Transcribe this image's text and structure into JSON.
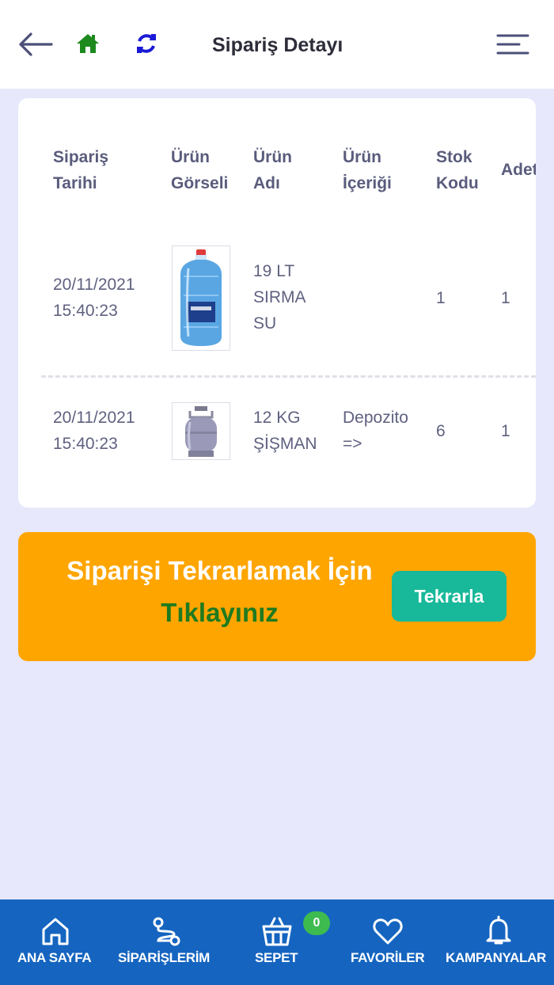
{
  "header": {
    "title": "Sipariş Detayı",
    "icons": [
      "arrow-left-icon",
      "home-icon",
      "refresh-icon",
      "hamburger-menu-icon"
    ]
  },
  "table": {
    "columns": [
      "Sipariş\nTarihi",
      "Ürün\nGörseli",
      "Ürün\nAdı",
      "Ürün\nİçeriği",
      "Stok\nKodu",
      "Adet"
    ],
    "rows": [
      {
        "date": "20/11/2021\n15:40:23",
        "image": "water-bottle-19lt",
        "name": "19 LT\nSIRMA\nSU",
        "content": "",
        "stock_code": "1",
        "quantity": "1"
      },
      {
        "date": "20/11/2021\n15:40:23",
        "image": "gas-cylinder-12kg",
        "name": "12 KG\nŞİŞMAN",
        "content": "Depozito\n=>",
        "stock_code": "6",
        "quantity": "1"
      }
    ]
  },
  "banner": {
    "line1": "Siparişi Tekrarlamak İçin",
    "line2": "Tıklayınız",
    "button_label": "Tekrarla"
  },
  "bottom_nav": {
    "items": [
      {
        "label": "ANA SAYFA",
        "icon": "home-outline-icon"
      },
      {
        "label": "SİPARİŞLERİM",
        "icon": "route-icon"
      },
      {
        "label": "SEPET",
        "icon": "basket-icon"
      },
      {
        "label": "FAVORİLER",
        "icon": "heart-icon"
      },
      {
        "label": "KAMPANYALAR",
        "icon": "bell-icon"
      }
    ],
    "cart_count": "0"
  },
  "colors": {
    "header_bg": "#ffffff",
    "page_bg": "#e8e8fc",
    "banner_bg": "#ffa500",
    "button_bg": "#18b89a",
    "nav_bg": "#1565c0",
    "badge_bg": "#3dbb4f",
    "home_icon": "#1e8a1e",
    "refresh_icon": "#1a1ad6"
  }
}
